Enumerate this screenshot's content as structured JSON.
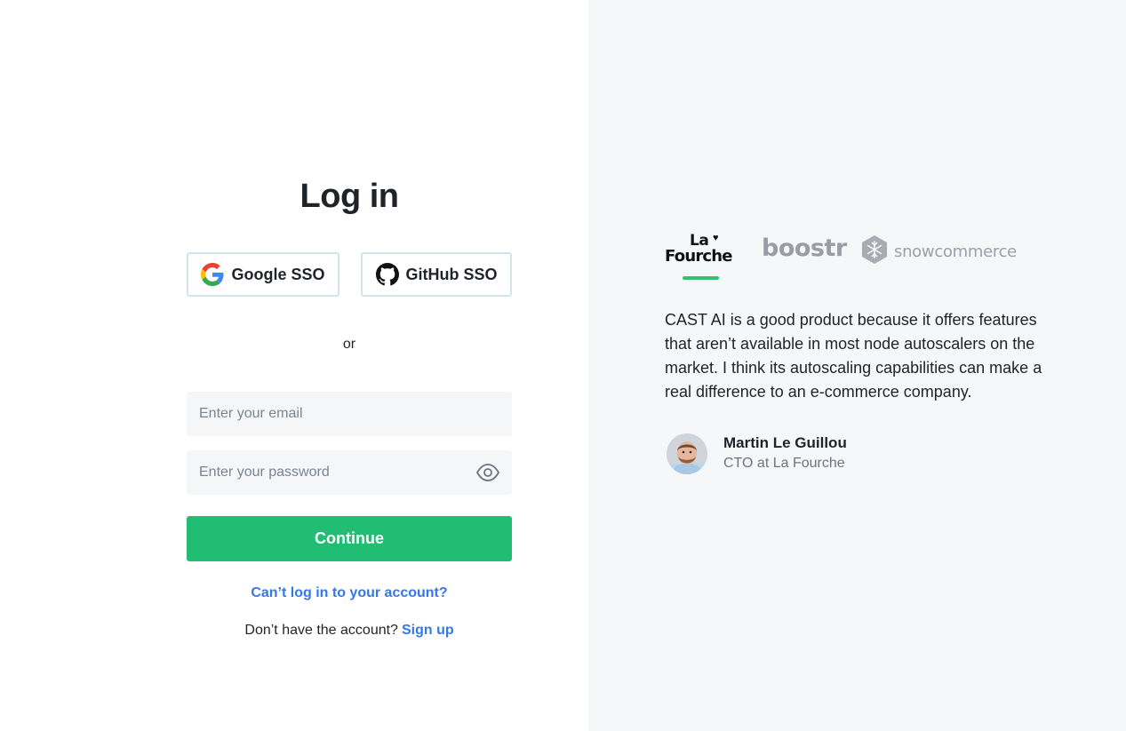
{
  "login": {
    "title": "Log in",
    "google_sso_label": "Google SSO",
    "github_sso_label": "GitHub SSO",
    "or_text": "or",
    "email_placeholder": "Enter your email",
    "password_placeholder": "Enter your password",
    "continue_label": "Continue",
    "forgot_link": "Can’t log in to your account?",
    "signup_prompt": "Don’t have the account?",
    "signup_link": "Sign up"
  },
  "testimonial": {
    "logos": [
      {
        "name": "la-fourche",
        "line1": "La",
        "line2": "Fourche",
        "active": true
      },
      {
        "name": "boostr",
        "text": "boostr",
        "active": false
      },
      {
        "name": "snowcommerce",
        "text": "snowcommerce",
        "active": false
      }
    ],
    "quote": "CAST AI is a good product because it offers features that aren’t available in most node autoscalers on the market. I think its autoscaling capabilities can make a real difference to an e-commerce company.",
    "author_name": "Martin Le Guillou",
    "author_role": "CTO at La Fourche"
  },
  "colors": {
    "primary_green": "#20bd73",
    "link_blue": "#3578e5",
    "right_panel_bg": "#f6f7f9"
  },
  "icons": {
    "google": "google-icon",
    "github": "github-icon",
    "eye": "eye-icon",
    "snowflake": "snowflake-icon"
  }
}
